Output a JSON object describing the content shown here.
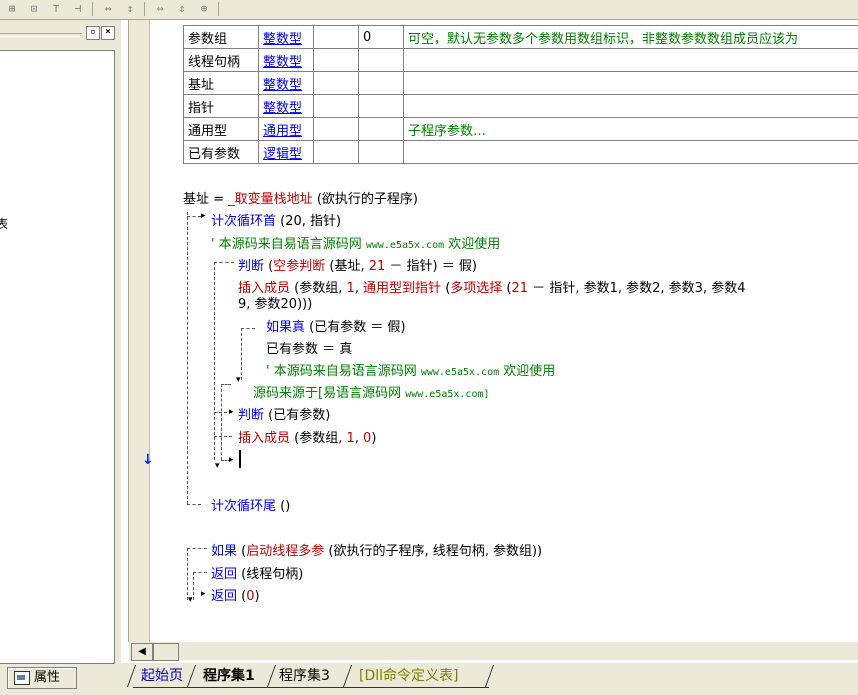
{
  "toolbar": {
    "buttons": [
      {
        "icon": "align-center-horizontal-icon",
        "glyph": "⊞"
      },
      {
        "icon": "align-center-vertical-icon",
        "glyph": "⊡"
      },
      {
        "icon": "align-top-icon",
        "glyph": "⊤"
      },
      {
        "icon": "align-right-icon",
        "glyph": "⊣"
      },
      {
        "icon": "space-horizontal-icon",
        "glyph": "↔"
      },
      {
        "icon": "space-vertical-icon",
        "glyph": "↕"
      },
      {
        "icon": "same-width-icon",
        "glyph": "⇔"
      },
      {
        "icon": "same-height-icon",
        "glyph": "⇕"
      },
      {
        "icon": "same-size-icon",
        "glyph": "⊕"
      }
    ]
  },
  "left_panel": {
    "close_glyph": "×",
    "restore_glyph": "▫",
    "fragment_text": "表",
    "properties_tab": "属性"
  },
  "params_table": {
    "rows": [
      {
        "name": "参数组",
        "type": "整数型",
        "c3": "",
        "c4": "0",
        "note": "可空，默认无参数多个参数用数组标识，非整数参数数组成员应该为"
      },
      {
        "name": "线程句柄",
        "type": "整数型",
        "c3": "",
        "c4": "",
        "note": ""
      },
      {
        "name": "基址",
        "type": "整数型",
        "c3": "",
        "c4": "",
        "note": ""
      },
      {
        "name": "指针",
        "type": "整数型",
        "c3": "",
        "c4": "",
        "note": ""
      },
      {
        "name": "通用型",
        "type": "通用型",
        "c3": "",
        "c4": "",
        "note": "子程序参数…"
      },
      {
        "name": "已有参数",
        "type": "逻辑型",
        "c3": "",
        "c4": "",
        "note": ""
      }
    ]
  },
  "code": {
    "l1": {
      "a": "基址 = ",
      "b": "_取变量栈地址",
      "c": " (欲执行的子程序)"
    },
    "l2": {
      "a": "计次循环首",
      "b": " (20, 指针)"
    },
    "l3": {
      "a": "' 本源码来自易语言源码网 ",
      "b": "www.e5a5x.com",
      "c": "  欢迎使用"
    },
    "l4": {
      "a": "判断",
      "b": " (",
      "c": "空参判断",
      "d": " (基址, ",
      "e": "21",
      "f": " － 指针) ＝ 假)"
    },
    "l5": {
      "a": "插入成员",
      "b": " (参数组, ",
      "c": "1",
      "d": ", ",
      "e": "通用型到指针",
      "f": " (",
      "g": "多项选择",
      "h": " (",
      "i": "21",
      "j": " － 指针, 参数1, 参数2, 参数3, 参数4"
    },
    "l6": {
      "a": "9, 参数20)))"
    },
    "l7": {
      "a": "如果真",
      "b": " (已有参数 ＝ 假)"
    },
    "l8": {
      "a": "已有参数 ＝ 真"
    },
    "l9": {
      "a": "' 本源码来自易语言源码网 ",
      "b": "www.e5a5x.com",
      "c": "  欢迎使用"
    },
    "l10": {
      "a": "源码来源于[易语言源码网 ",
      "b": "www.e5a5x.com]"
    },
    "l11": {
      "a": "判断",
      "b": " (已有参数)"
    },
    "l12": {
      "a": "插入成员",
      "b": " (参数组, ",
      "c": "1",
      "d": ", ",
      "e": "0",
      "f": ")"
    },
    "l13": {
      "a": "计次循环尾",
      "b": " ()"
    },
    "l14": {
      "a": "如果",
      "b": " (",
      "c": "启动线程多参",
      "d": " (欲执行的子程序, 线程句柄, 参数组))"
    },
    "l15": {
      "a": "返回",
      "b": " (线程句柄)"
    },
    "l16": {
      "a": "返回",
      "b": " (",
      "c": "0",
      "d": ")"
    }
  },
  "margin": {
    "arrow_glyph": "↓"
  },
  "scroll": {
    "left_glyph": "◀"
  },
  "tabs": [
    {
      "label": "起始页",
      "color": "#0000c0",
      "bold": false
    },
    {
      "label": "程序集1",
      "color": "#000000",
      "bold": true
    },
    {
      "label": "程序集3",
      "color": "#000000",
      "bold": false
    },
    {
      "label": "[Dll命令定义表]",
      "color": "#808000",
      "bold": false
    }
  ],
  "colors": {
    "keyword": "#0000ff",
    "function": "#c00000",
    "comment": "#008000",
    "chrome": "#ece9d8"
  }
}
